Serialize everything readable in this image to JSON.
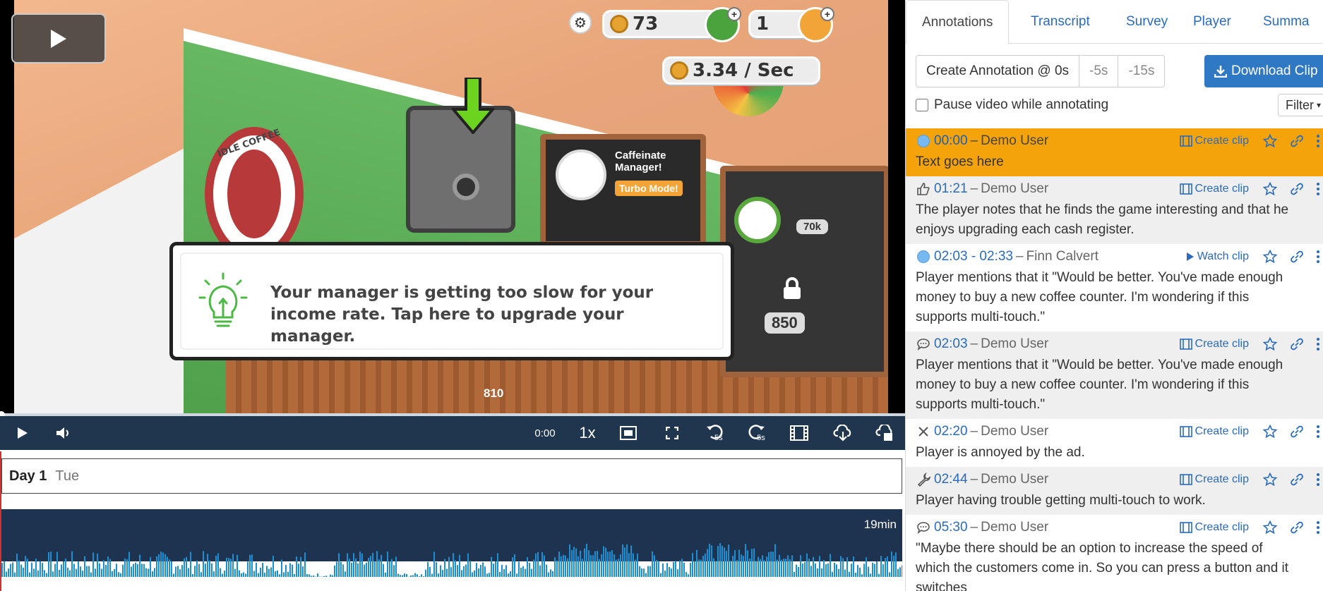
{
  "video": {
    "hud": {
      "coins": "73",
      "gems": "1",
      "rate": "3.34 / Sec"
    },
    "scene": {
      "logo": "IDLE COFFEE",
      "menu_title": "Caffeinate Manager!",
      "turbo": "Turbo Mode!",
      "price_70k": "70k",
      "price_850": "850",
      "price_810": "810"
    },
    "tooltip": "Your manager is getting too slow for your income rate. Tap here to upgrade your manager.",
    "controls": {
      "time": "0:00",
      "rate": "1x",
      "back": "-5s",
      "fwd": "5s"
    }
  },
  "day_bar": {
    "day": "Day 1",
    "dow": "Tue"
  },
  "timeline": {
    "duration": "19min"
  },
  "tabs": [
    "Annotations",
    "Transcript",
    "Survey",
    "Player",
    "Summa"
  ],
  "toolbar": {
    "create": "Create Annotation @ 0s",
    "back5": "-5s",
    "back15": "-15s",
    "download": "Download Clip",
    "pause": "Pause video while annotating",
    "filter": "Filter"
  },
  "annotations": [
    {
      "icon": "dot",
      "time": "00:00",
      "user": "Demo User",
      "action": "Create clip",
      "text": "Text goes here"
    },
    {
      "icon": "thumbs-up",
      "time": "01:21",
      "user": "Demo User",
      "action": "Create clip",
      "text": "The player notes that he finds the game interesting and that he enjoys upgrading each cash register."
    },
    {
      "icon": "dot",
      "time": "02:03  - 02:33",
      "user": "Finn Calvert",
      "action": "Watch clip",
      "text": "Player mentions that it \"Would be better. You've made enough money to buy a new coffee counter. I'm wondering if this supports multi-touch.\""
    },
    {
      "icon": "comment",
      "time": "02:03",
      "user": "Demo User",
      "action": "Create clip",
      "text": "Player mentions that it \"Would be better. You've made enough money to buy a new coffee counter. I'm wondering if this supports multi-touch.\""
    },
    {
      "icon": "x",
      "time": "02:20",
      "user": "Demo User",
      "action": "Create clip",
      "text": "Player is annoyed by the ad."
    },
    {
      "icon": "wrench",
      "time": "02:44",
      "user": "Demo User",
      "action": "Create clip",
      "text": "Player having trouble getting multi-touch to work."
    },
    {
      "icon": "comment",
      "time": "05:30",
      "user": "Demo User",
      "action": "Create clip",
      "text": "\"Maybe there should be an option to increase the speed of which the customers come in. So you can press a button and it switches"
    }
  ],
  "colors": {
    "highlight": "#f5a30a",
    "link": "#2a6bbd",
    "controls_bg": "#20364e",
    "timeline_bg": "#1d3350",
    "waveform": "#1a8fd1"
  }
}
